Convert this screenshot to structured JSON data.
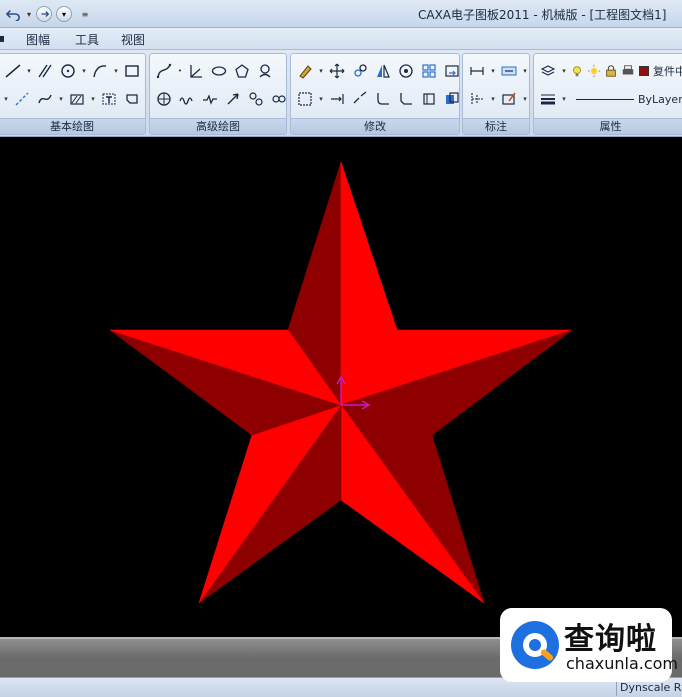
{
  "window": {
    "title": "CAXA电子图板2011 - 机械版 - [工程图文档1]"
  },
  "menu": {
    "items": [
      "图幅",
      "工具",
      "视图"
    ]
  },
  "ribbon": {
    "groups": [
      {
        "label": "基本绘图"
      },
      {
        "label": "高级绘图"
      },
      {
        "label": "修改"
      },
      {
        "label": "标注"
      },
      {
        "label": "属性"
      }
    ],
    "properties": {
      "layer_text": "复件中",
      "linetype_text": "ByLayer"
    }
  },
  "canvas": {
    "star_colors": {
      "light": "#ff0000",
      "dark": "#8e0000"
    },
    "cursor_color": "#c020c0"
  },
  "status": {
    "dynscale": "Dynscale Rt"
  },
  "watermark": {
    "cn": "查询啦",
    "en": "chaxunla.com"
  }
}
